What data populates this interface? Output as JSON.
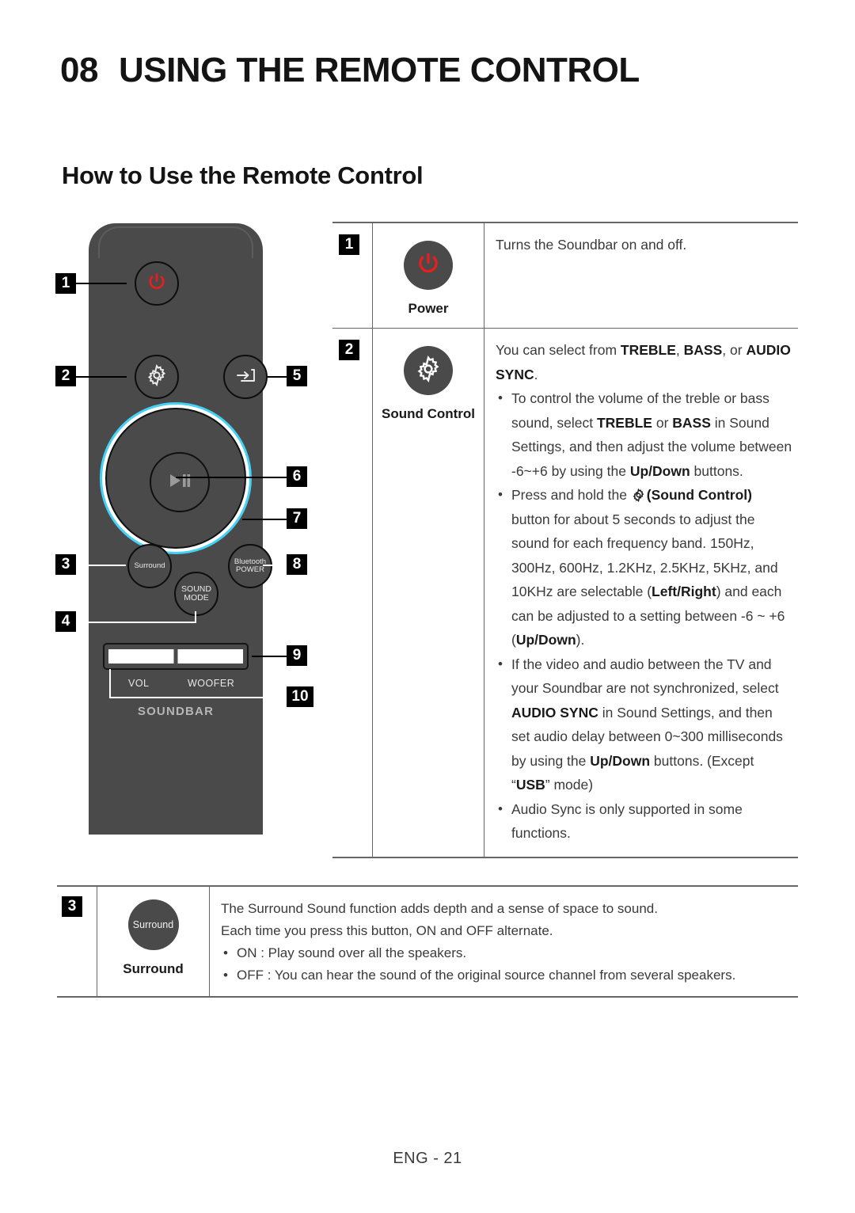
{
  "header": {
    "chapter_number": "08",
    "chapter_title": "USING THE REMOTE CONTROL",
    "section_title": "How to Use the Remote Control"
  },
  "remote": {
    "buttons": {
      "power": "power-icon",
      "sound_control": "gear-icon",
      "source": "source-input-icon",
      "play_pause": "play-pause-icon",
      "surround": "Surround",
      "sound_mode_line1": "SOUND",
      "sound_mode_line2": "MODE",
      "bluetooth_line1": "Bluetooth",
      "bluetooth_line2": "POWER"
    },
    "rocker": {
      "vol_label": "VOL",
      "woofer_label": "WOOFER"
    },
    "brand_label": "SOUNDBAR",
    "markers": {
      "m1": "1",
      "m2": "2",
      "m3": "3",
      "m4": "4",
      "m5": "5",
      "m6": "6",
      "m7": "7",
      "m8": "8",
      "m9": "9",
      "m10": "10"
    }
  },
  "table": {
    "row1": {
      "number": "1",
      "icon": "power-icon",
      "caption": "Power",
      "description": "Turns the Soundbar on and off."
    },
    "row2": {
      "number": "2",
      "icon": "gear-icon",
      "caption": "Sound Control",
      "intro_a": "You can select from ",
      "intro_b": "TREBLE",
      "intro_c": ", ",
      "intro_d": "BASS",
      "intro_e": ", or ",
      "intro_f": "AUDIO SYNC",
      "intro_g": ".",
      "bullets": [
        {
          "parts": [
            {
              "t": "To control the volume of the treble or bass sound, select "
            },
            {
              "t": "TREBLE",
              "b": true
            },
            {
              "t": " or "
            },
            {
              "t": "BASS",
              "b": true
            },
            {
              "t": " in Sound Settings, and then adjust the volume between -6~+6 by using the "
            },
            {
              "t": "Up/Down",
              "b": true
            },
            {
              "t": " buttons."
            }
          ]
        },
        {
          "parts": [
            {
              "t": "Press and hold the "
            },
            {
              "t": "[gear]",
              "icon": true
            },
            {
              "t": "(Sound Control)",
              "b": true
            },
            {
              "t": " button for about 5 seconds to adjust the sound for each frequency band. 150Hz, 300Hz, 600Hz, 1.2KHz, 2.5KHz, 5KHz, and 10KHz are selectable ("
            },
            {
              "t": "Left/Right",
              "b": true
            },
            {
              "t": ") and each can be adjusted to a setting between -6 ~ +6 ("
            },
            {
              "t": "Up/Down",
              "b": true
            },
            {
              "t": ")."
            }
          ]
        },
        {
          "parts": [
            {
              "t": "If the video and audio between the TV and your Soundbar are not synchronized, select "
            },
            {
              "t": "AUDIO SYNC",
              "b": true
            },
            {
              "t": " in Sound Settings, and then set audio delay between 0~300 milliseconds by using the "
            },
            {
              "t": "Up/Down",
              "b": true
            },
            {
              "t": " buttons. (Except “"
            },
            {
              "t": "USB",
              "b": true
            },
            {
              "t": "” mode)"
            }
          ]
        },
        {
          "parts": [
            {
              "t": "Audio Sync is only supported in some functions."
            }
          ]
        }
      ]
    },
    "row3": {
      "number": "3",
      "icon_label": "Surround",
      "caption": "Surround",
      "line1": "The Surround Sound function adds depth and a sense of space to sound.",
      "line2": "Each time you press this button, ON and OFF alternate.",
      "bullets": [
        "ON : Play sound over all the speakers.",
        "OFF : You can hear the sound of the original source channel from several speakers."
      ]
    }
  },
  "footer": {
    "page_label": "ENG - 21"
  },
  "colors": {
    "accent_cyan": "#45d0f5",
    "power_red": "#ee1c1c",
    "remote_body": "#4a4a4a",
    "marker_bg": "#000000"
  }
}
